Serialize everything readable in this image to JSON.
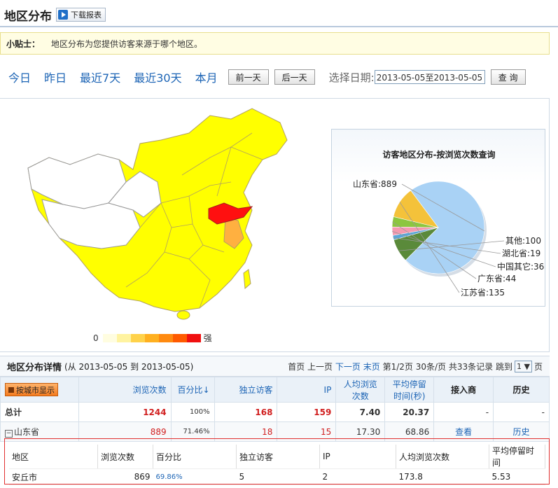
{
  "header": {
    "title": "地区分布",
    "download_label": "下载报表"
  },
  "tip": {
    "label": "小贴士：",
    "text": "地区分布为您提供访客来源于哪个地区。"
  },
  "date_nav": {
    "links": [
      "今日",
      "昨日",
      "最近7天",
      "最近30天",
      "本月"
    ],
    "prev_label": "前一天",
    "next_label": "后一天",
    "select_label": "选择日期:",
    "date_value": "2013-05-05至2013-05-05",
    "query_label": "查 询"
  },
  "legend": {
    "min_label": "0",
    "max_label": "强",
    "colors": [
      "#fffde0",
      "#fff3a0",
      "#ffd24a",
      "#ffb020",
      "#ff8a10",
      "#ff5a00",
      "#f01010"
    ]
  },
  "chart_data": {
    "type": "pie",
    "title": "访客地区分布-按浏览次数查询",
    "labels": [
      "山东省",
      "江苏省",
      "广东省",
      "中国其它",
      "湖北省",
      "其他"
    ],
    "values": [
      889,
      135,
      44,
      36,
      19,
      100
    ],
    "label_texts": [
      "山东省:889",
      "江苏省:135",
      "广东省:44",
      "中国其它:36",
      "湖北省:19",
      "其他:100"
    ],
    "colors": [
      "#a9d2f5",
      "#f4c23a",
      "#8cc63f",
      "#f59ab0",
      "#5aa6d8",
      "#5a8a3a"
    ]
  },
  "detail": {
    "title": "地区分布详情",
    "range": "(从 2013-05-05 到 2013-05-05)",
    "pager": {
      "first": "首页",
      "prev": "上一页",
      "next": "下一页",
      "last": "末页",
      "page_info": "第1/2页",
      "per_page": "30条/页",
      "total": "共33条记录",
      "jump": "跳到",
      "page_value": "1",
      "page_suffix": "页"
    }
  },
  "table": {
    "city_button": "按城市显示",
    "headers": [
      "浏览次数",
      "百分比↓",
      "独立访客",
      "IP",
      "人均浏览次数",
      "平均停留时间(秒)",
      "接入商",
      "历史"
    ],
    "total_row": {
      "name": "总计",
      "pv": "1244",
      "pct": "100%",
      "uv": "168",
      "ip": "159",
      "avg_pv": "7.40",
      "avg_time": "20.37",
      "isp": "-",
      "hist": "-"
    },
    "province_row": {
      "name": "山东省",
      "pv": "889",
      "pct": "71.46%",
      "uv": "18",
      "ip": "15",
      "avg_pv": "17.30",
      "avg_time": "68.86",
      "isp": "查看",
      "hist": "历史"
    }
  },
  "subtable": {
    "headers": [
      "地区",
      "浏览次数",
      "百分比",
      "独立访客",
      "IP",
      "人均浏览次数",
      "平均停留时间"
    ],
    "row": {
      "name": "安丘市",
      "pv": "869",
      "pct": "69.86%",
      "uv": "5",
      "ip": "2",
      "avg_pv": "173.8",
      "avg_time": "5.53"
    }
  }
}
